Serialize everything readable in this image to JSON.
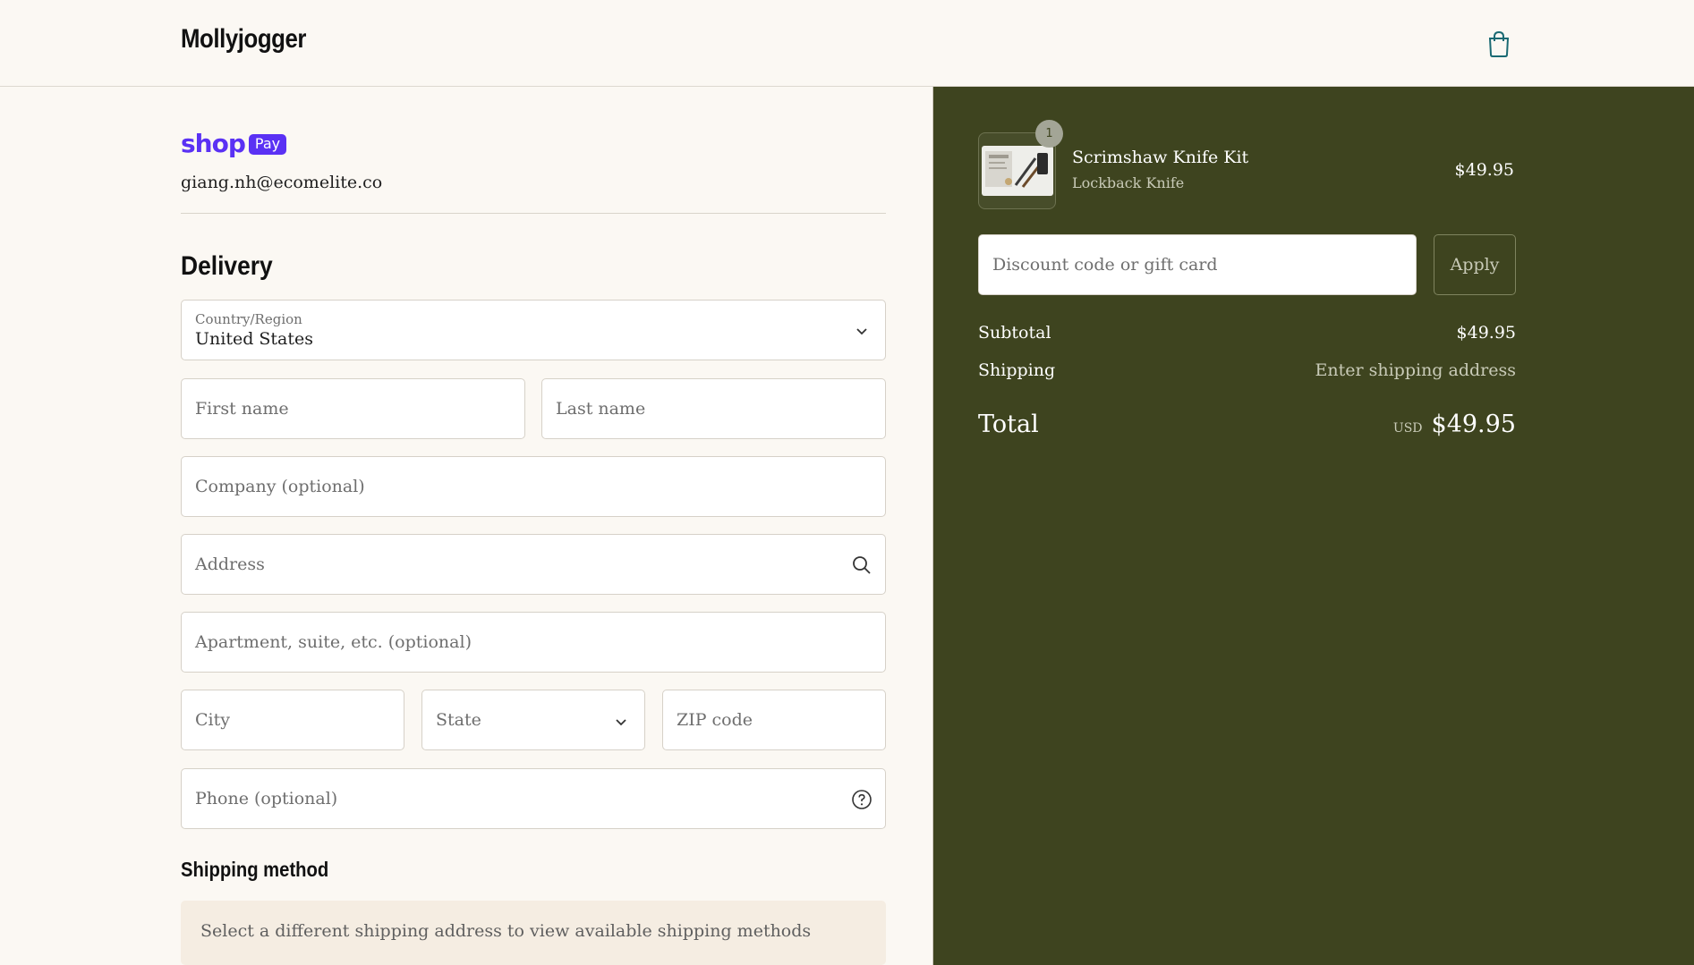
{
  "header": {
    "brand": "Mollyjogger",
    "cart_icon": "shopping-bag-icon"
  },
  "express": {
    "shop_label": "shop",
    "pay_label": "Pay",
    "email": "giang.nh@ecomelite.co"
  },
  "delivery": {
    "title": "Delivery",
    "country": {
      "label": "Country/Region",
      "value": "United States"
    },
    "first_name": "First name",
    "last_name": "Last name",
    "company": "Company (optional)",
    "address": "Address",
    "apartment": "Apartment, suite, etc. (optional)",
    "city": "City",
    "state": "State",
    "zip": "ZIP code",
    "phone": "Phone (optional)"
  },
  "shipping_method": {
    "title": "Shipping method",
    "note": "Select a different shipping address to view available shipping methods"
  },
  "summary": {
    "item": {
      "quantity": "1",
      "name": "Scrimshaw Knife Kit",
      "variant": "Lockback Knife",
      "price": "$49.95"
    },
    "discount_placeholder": "Discount code or gift card",
    "apply_label": "Apply",
    "subtotal_label": "Subtotal",
    "subtotal_value": "$49.95",
    "shipping_label": "Shipping",
    "shipping_value": "Enter shipping address",
    "total_label": "Total",
    "currency": "USD",
    "total_value": "$49.95"
  },
  "colors": {
    "accent": "#3e441f",
    "shop_pay": "#5a31f4",
    "background": "#fbf8f3"
  }
}
